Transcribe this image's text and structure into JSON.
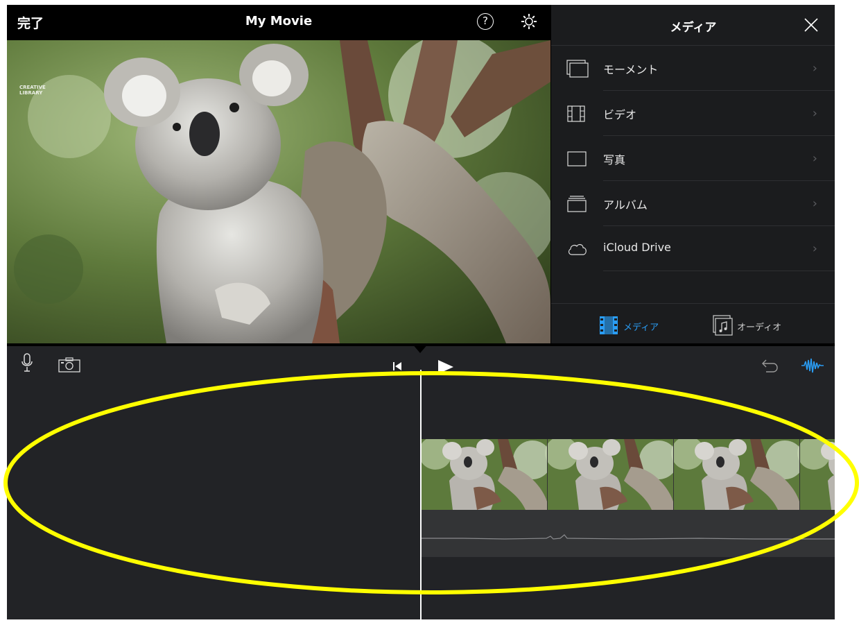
{
  "header": {
    "done_label": "完了",
    "title": "My Movie",
    "help_symbol": "?"
  },
  "viewer": {
    "watermark_lines": [
      "CREATIVE",
      "LIBRARY"
    ]
  },
  "media_panel": {
    "title": "メディア",
    "items": [
      {
        "label": "モーメント",
        "icon": "moments-icon"
      },
      {
        "label": "ビデオ",
        "icon": "film-icon"
      },
      {
        "label": "写真",
        "icon": "photo-icon"
      },
      {
        "label": "アルバム",
        "icon": "album-icon"
      },
      {
        "label": "iCloud Drive",
        "icon": "cloud-icon"
      }
    ],
    "chevron": "›",
    "tabs": [
      {
        "label": "メディア",
        "icon": "film-icon",
        "active": true
      },
      {
        "label": "オーディオ",
        "icon": "music-note-icon",
        "active": false
      }
    ]
  },
  "colors": {
    "accent": "#2a9df4",
    "highlight": "#ffff00",
    "background": "#222326"
  }
}
